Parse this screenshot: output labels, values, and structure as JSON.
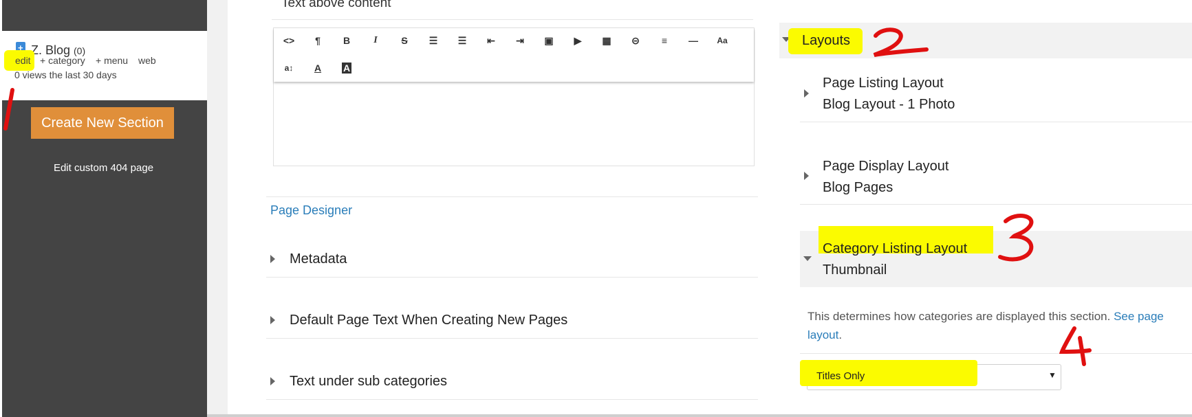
{
  "sidebar": {
    "site": {
      "name": "Z. Blog",
      "count": "(0)",
      "actions": [
        "edit",
        "+ category",
        "+ menu",
        "web"
      ],
      "views": "0 views the last 30 days"
    },
    "create_button": "Create New Section",
    "edit_404": "Edit custom 404 page"
  },
  "editor": {
    "text_above_label": "Text above content",
    "toolbar_row1": [
      "<>",
      "¶",
      "B",
      "I",
      "S",
      "ul",
      "ol",
      "outdent",
      "indent",
      "image",
      "video",
      "table",
      "link",
      "align",
      "hr",
      "Aa"
    ],
    "toolbar_row2": [
      "a↕",
      "A",
      "A"
    ]
  },
  "left_panels": {
    "page_designer_link": "Page Designer",
    "sections": [
      "Metadata",
      "Default Page Text When Creating New Pages",
      "Text under sub categories"
    ]
  },
  "layouts": {
    "header": "Layouts",
    "items": [
      {
        "title": "Page Listing Layout",
        "value": "Blog Layout - 1 Photo"
      },
      {
        "title": "Page Display Layout",
        "value": "Blog Pages"
      },
      {
        "title": "Category Listing Layout",
        "value": "Thumbnail"
      }
    ],
    "description": "This determines how categories are displayed this section.",
    "description_link": "See page",
    "description_link2": "layout",
    "select_value": "Titles Only"
  },
  "annotations": [
    "1",
    "2",
    "3",
    "4"
  ],
  "colors": {
    "sidebar": "#444444",
    "orange": "#e08f3a",
    "highlight": "#fbfb00",
    "annotation": "#e01010",
    "link": "#2a7db9"
  }
}
